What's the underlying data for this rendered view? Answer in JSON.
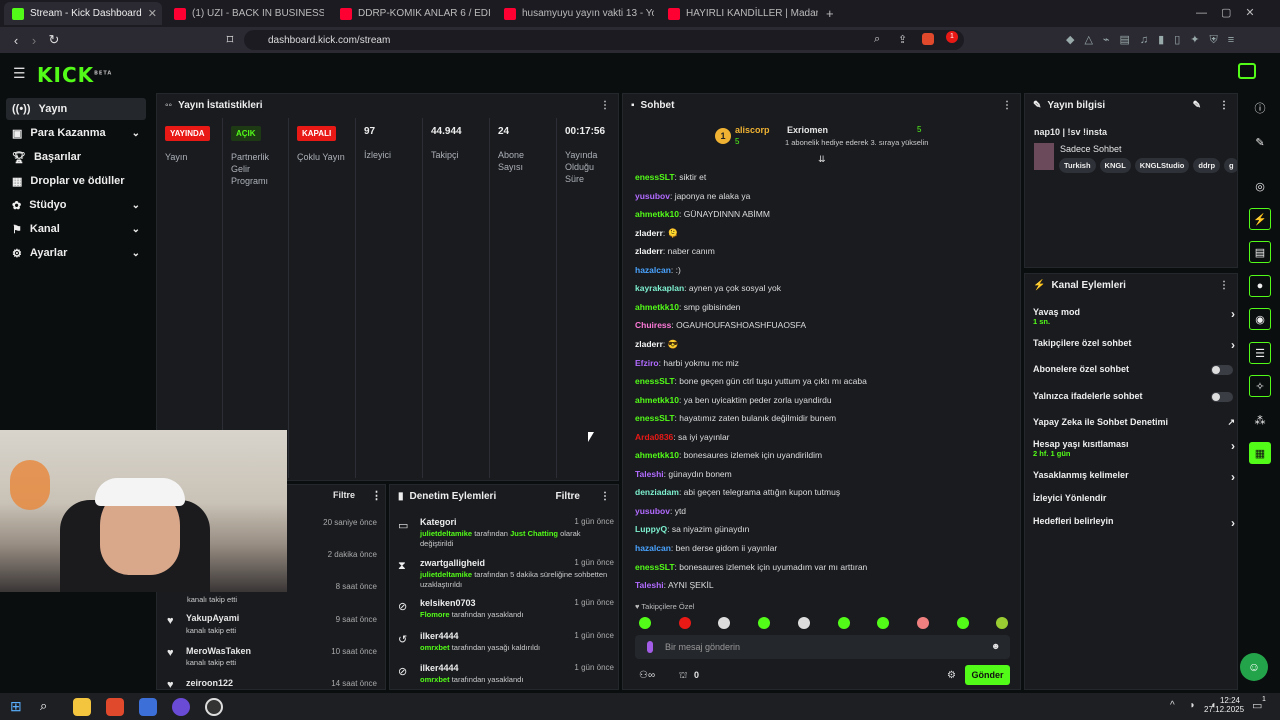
{
  "browser": {
    "tabs": [
      {
        "label": "Stream - Kick Dashboard",
        "color": "#53fc18",
        "active": true
      },
      {
        "label": "(1) UZI - BACK IN BUSINESS - Yo",
        "color": "#ff0033"
      },
      {
        "label": "DDRP-KOMIK ANLAR 6 / EDITLI - You",
        "color": "#ff0033"
      },
      {
        "label": "husamyuyu yayın vakti 13 - YouTube",
        "color": "#ff0033"
      },
      {
        "label": "HAYIRLI KANDİLLER | Madara Olduk -",
        "color": "#ff0033"
      }
    ],
    "url": "dashboard.kick.com/stream",
    "new_tab": "+",
    "ext_badge": "1"
  },
  "topnav": {
    "logo": "KICK",
    "beta": "BETA"
  },
  "sidebar": {
    "items": [
      {
        "label": "Yayın",
        "icon": "broadcast-icon",
        "active": true
      },
      {
        "label": "Para Kazanma",
        "icon": "money-icon",
        "chev": "⌄"
      },
      {
        "label": "Başarılar",
        "icon": "trophy-icon"
      },
      {
        "label": "Droplar ve ödüller",
        "icon": "gift-icon"
      },
      {
        "label": "Stüdyo",
        "icon": "gear-icon",
        "chev": "⌄"
      },
      {
        "label": "Kanal",
        "icon": "channel-icon",
        "chev": "⌄"
      },
      {
        "label": "Ayarlar",
        "icon": "settings-icon",
        "chev": "⌄"
      }
    ]
  },
  "stats": {
    "title": "Yayın İstatistikleri",
    "items": [
      {
        "badge": "YAYINDA",
        "badge_color": "#e91916",
        "label": "Yayın"
      },
      {
        "badge": "AÇIK",
        "badge_color": "#53fc18",
        "label": "Partnerlik Gelir Programı"
      },
      {
        "badge": "KAPALI",
        "badge_color": "#e91916",
        "label": "Çoklu Yayın"
      },
      {
        "value": "97",
        "label": "İzleyici"
      },
      {
        "value": "44.944",
        "label": "Takipçi"
      },
      {
        "value": "24",
        "label": "Abone Sayısı"
      },
      {
        "value": "00:17:56",
        "label": "Yayında Olduğu Süre"
      }
    ]
  },
  "activity": {
    "filter": "Filtre",
    "rows": [
      {
        "time": "20 saniye önce"
      },
      {
        "time": "2 dakika önce"
      },
      {
        "time": "8 saat önce",
        "desc": "kanalı takip etti"
      },
      {
        "name": "YakupAyami",
        "desc": "kanalı takip etti",
        "time": "9 saat önce"
      },
      {
        "name": "MeroWasTaken",
        "desc": "kanalı takip etti",
        "time": "10 saat önce"
      },
      {
        "name": "zeiroon122",
        "time": "14 saat önce"
      }
    ]
  },
  "moderation": {
    "title": "Denetim Eylemleri",
    "filter": "Filtre",
    "rows": [
      {
        "name": "Kategori",
        "time": "1 gün önce",
        "mod": "julietdeltamike",
        "text1": "tarafından",
        "cat": "Just Chatting",
        "text2": "olarak değiştirildi"
      },
      {
        "name": "zwartgalligheid",
        "time": "1 gün önce",
        "mod": "julietdeltamike",
        "text1": "tarafından 5 dakika süreliğine sohbetten uzaklaştırıldı"
      },
      {
        "name": "kelsiken0703",
        "time": "1 gün önce",
        "mod": "Flomore",
        "text1": "tarafından yasaklandı"
      },
      {
        "name": "ilker4444",
        "time": "1 gün önce",
        "mod": "omrxbet",
        "text1": "tarafından yasağı kaldırıldı"
      },
      {
        "name": "ilker4444",
        "time": "1 gün önce",
        "mod": "omrxbet",
        "text1": "tarafından yasaklandı"
      }
    ]
  },
  "chat": {
    "title": "Sohbet",
    "pinned": {
      "rank": "1",
      "user1": "aliscorp",
      "count1": "5",
      "user2": "Exriomen",
      "count2": "5",
      "note": "1 abonelik hediye ederek 3. sıraya yükselin"
    },
    "messages": [
      {
        "user": "enessSLT",
        "color": "#53fc18",
        "text": "siktir et"
      },
      {
        "user": "yusubov",
        "color": "#b26bff",
        "text": "japonya ne alaka ya"
      },
      {
        "user": "ahmetkk10",
        "color": "#53fc18",
        "text": "GÜNAYDINNN ABİMM"
      },
      {
        "user": "zladerr",
        "color": "#f5f5f5",
        "text": "🫠"
      },
      {
        "user": "zladerr",
        "color": "#f5f5f5",
        "text": "naber canım"
      },
      {
        "user": "hazalcan",
        "color": "#4aa3ff",
        "text": ":)"
      },
      {
        "user": "kayrakaplan",
        "color": "#7ef0d0",
        "text": "aynen ya çok sosyal yok"
      },
      {
        "user": "ahmetkk10",
        "color": "#53fc18",
        "text": "smp gibisinden"
      },
      {
        "user": "Chuiress",
        "color": "#ff7ad9",
        "text": "OGAUHOUFASHOASHFUAOSFA"
      },
      {
        "user": "zladerr",
        "color": "#f5f5f5",
        "text": "😎"
      },
      {
        "user": "Efziro",
        "color": "#b26bff",
        "text": "harbi yokmu mc miz"
      },
      {
        "user": "enessSLT",
        "color": "#53fc18",
        "text": "bone geçen gün ctrl tuşu yuttum ya çıktı mı acaba"
      },
      {
        "user": "ahmetkk10",
        "color": "#53fc18",
        "text": "ya ben uyicaktim peder zorla uyandirdu"
      },
      {
        "user": "enessSLT",
        "color": "#53fc18",
        "text": "hayatımız zaten bulanık değilmidir bunem"
      },
      {
        "user": "Arda0836",
        "color": "#e91916",
        "text": "sa iyi yayınlar"
      },
      {
        "user": "ahmetkk10",
        "color": "#53fc18",
        "text": "bonesaures izlemek için uyandirildim"
      },
      {
        "user": "Taleshi",
        "color": "#b26bff",
        "text": "günaydın bonem"
      },
      {
        "user": "denziadam",
        "color": "#7ef0d0",
        "text": "abi geçen telegrama attığın kupon tutmuş"
      },
      {
        "user": "yusubov",
        "color": "#b26bff",
        "text": "ytd"
      },
      {
        "user": "LuppyQ",
        "color": "#7ef0d0",
        "text": "sa niyazim günaydın"
      },
      {
        "user": "hazalcan",
        "color": "#4aa3ff",
        "text": "ben derse gidom ii yayınlar"
      },
      {
        "user": "enessSLT",
        "color": "#53fc18",
        "text": "bonesaures izlemek için uyumadım var mı arttıran"
      },
      {
        "user": "Taleshi",
        "color": "#b26bff",
        "text": "AYNI ŞEKİL"
      }
    ],
    "followers_only": "Takipçilere Özel",
    "input_placeholder": "Bir mesaj gönderin",
    "count": "0",
    "send": "Gönder"
  },
  "info": {
    "title": "Yayın bilgisi",
    "stream_title": "nap10 | !sv !insta",
    "category": "Sadece Sohbet",
    "tags": [
      "Turkish",
      "KNGL",
      "KNGLStudio",
      "ddrp",
      "g"
    ]
  },
  "channel_actions": {
    "title": "Kanal Eylemleri",
    "items": [
      {
        "label": "Yavaş mod",
        "sub": "1 sn.",
        "kind": "arrow"
      },
      {
        "label": "Takipçilere özel sohbet",
        "kind": "arrow"
      },
      {
        "label": "Abonelere özel sohbet",
        "kind": "toggle"
      },
      {
        "label": "Yalnızca ifadelerle sohbet",
        "kind": "toggle"
      },
      {
        "label": "Yapay Zeka ile Sohbet Denetimi",
        "kind": "ext"
      },
      {
        "label": "Hesap yaşı kısıtlaması",
        "sub": "2 hf. 1 gün",
        "kind": "arrow"
      },
      {
        "label": "Yasaklanmış kelimeler",
        "kind": "arrow"
      },
      {
        "label": "İzleyici Yönlendir",
        "kind": "none"
      },
      {
        "label": "Hedefleri belirleyin",
        "kind": "arrow"
      }
    ]
  },
  "taskbar": {
    "time": "12:24",
    "date": "27.12.2025",
    "notif_badge": "1"
  }
}
